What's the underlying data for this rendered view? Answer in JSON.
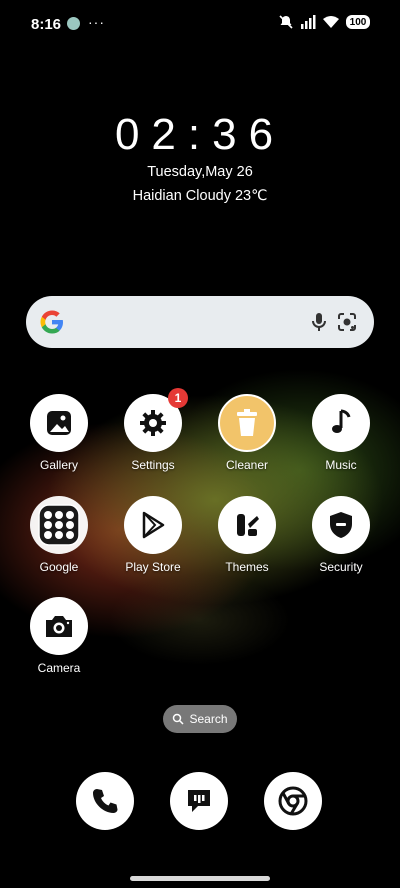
{
  "status": {
    "time": "8:16",
    "more": "···",
    "battery": "100"
  },
  "clock": {
    "time": "02:36",
    "date": "Tuesday,May 26",
    "weather": "Haidian Cloudy 23℃"
  },
  "apps": [
    {
      "label": "Gallery",
      "icon": "gallery-icon"
    },
    {
      "label": "Settings",
      "icon": "gear-icon",
      "badge": "1"
    },
    {
      "label": "Cleaner",
      "icon": "trash-icon"
    },
    {
      "label": "Music",
      "icon": "music-note-icon"
    },
    {
      "label": "Google",
      "icon": "google-folder-icon"
    },
    {
      "label": "Play Store",
      "icon": "play-store-icon"
    },
    {
      "label": "Themes",
      "icon": "themes-icon"
    },
    {
      "label": "Security",
      "icon": "shield-icon"
    },
    {
      "label": "Camera",
      "icon": "camera-icon"
    }
  ],
  "search_pill": {
    "label": "Search",
    "icon": "search-icon"
  },
  "dock": [
    {
      "icon": "phone-icon"
    },
    {
      "icon": "messages-icon"
    },
    {
      "icon": "chrome-icon"
    }
  ],
  "colors": {
    "search_bar": "#e8ecef",
    "badge": "#e53935",
    "cleaner_bg": "#f2c46a"
  }
}
